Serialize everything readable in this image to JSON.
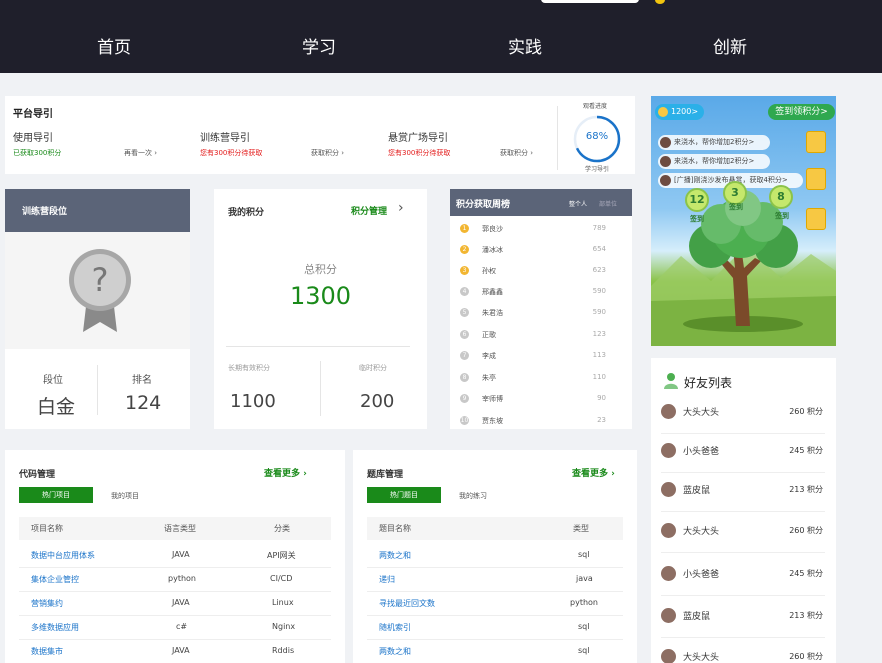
{
  "nav": {
    "items": [
      "首页",
      "学习",
      "实践",
      "创新"
    ]
  },
  "guide": {
    "title": "平台导引",
    "items": [
      {
        "name": "使用导引",
        "status": "已获取300积分",
        "action": "再看一次"
      },
      {
        "name": "训练营导引",
        "status": "您有300积分待获取",
        "action": "获取积分"
      },
      {
        "name": "悬赏广场导引",
        "status": "您有300积分待获取",
        "action": "获取积分"
      }
    ],
    "progress_title": "观看进度",
    "progress_value": 68,
    "progress_text": "68%",
    "progress_label": "学习导引"
  },
  "rank": {
    "title": "训练营段位",
    "level_label": "段位",
    "level_value": "白金",
    "rank_label": "排名",
    "rank_value": "124"
  },
  "points": {
    "title": "我的积分",
    "manage": "积分管理",
    "total_label": "总积分",
    "total_value": "1300",
    "long_label": "长期有效积分",
    "long_value": "1100",
    "temp_label": "临时积分",
    "temp_value": "200"
  },
  "weekly": {
    "title": "积分获取周榜",
    "tab_personal": "整个人",
    "tab_other": "部单位",
    "rows": [
      {
        "rank": "1",
        "name": "郭良沙",
        "score": "789"
      },
      {
        "rank": "2",
        "name": "潘冰冰",
        "score": "654"
      },
      {
        "rank": "3",
        "name": "孙权",
        "score": "623"
      },
      {
        "rank": "4",
        "name": "邢鑫鑫",
        "score": "590"
      },
      {
        "rank": "5",
        "name": "朱君浩",
        "score": "590"
      },
      {
        "rank": "6",
        "name": "正歌",
        "score": "123"
      },
      {
        "rank": "7",
        "name": "李成",
        "score": "113"
      },
      {
        "rank": "8",
        "name": "朱亭",
        "score": "110"
      },
      {
        "rank": "9",
        "name": "宰师博",
        "score": "90"
      },
      {
        "rank": "10",
        "name": "贾东坡",
        "score": "23"
      }
    ]
  },
  "game": {
    "coins": "1200>",
    "sign_button": "签到领积分>",
    "messages": [
      "来浇水，帮你增加2积分>",
      "来浇水，帮你增加2积分>",
      "[广播]刚浇沙发布悬赏，获取4积分>"
    ],
    "orbs": [
      {
        "value": "12",
        "label": "签到"
      },
      {
        "value": "3",
        "label": "签到"
      },
      {
        "value": "8",
        "label": "签到"
      }
    ]
  },
  "friends": {
    "title": "好友列表",
    "list": [
      {
        "name": "大头大头",
        "points": "260 积分"
      },
      {
        "name": "小头爸爸",
        "points": "245 积分"
      },
      {
        "name": "蓝皮鼠",
        "points": "213 积分"
      },
      {
        "name": "大头大头",
        "points": "260 积分"
      },
      {
        "name": "小头爸爸",
        "points": "245 积分"
      },
      {
        "name": "蓝皮鼠",
        "points": "213 积分"
      },
      {
        "name": "大头大头",
        "points": "260 积分"
      }
    ]
  },
  "code": {
    "title": "代码管理",
    "more": "查看更多",
    "tab_hot": "热门项目",
    "tab_mine": "我的项目",
    "headers": [
      "项目名称",
      "语言类型",
      "分类"
    ],
    "rows": [
      [
        "数据中台应用体系",
        "JAVA",
        "API网关"
      ],
      [
        "集体企业管控",
        "python",
        "CI/CD"
      ],
      [
        "营销集约",
        "JAVA",
        "Linux"
      ],
      [
        "多维数据应用",
        "c#",
        "Nginx"
      ],
      [
        "数据集市",
        "JAVA",
        "Rddis"
      ]
    ]
  },
  "questions": {
    "title": "题库管理",
    "more": "查看更多",
    "tab_hot": "热门题目",
    "tab_mine": "我的练习",
    "headers": [
      "题目名称",
      "类型"
    ],
    "rows": [
      [
        "两数之和",
        "sql"
      ],
      [
        "递归",
        "java"
      ],
      [
        "寻找最近回文数",
        "python"
      ],
      [
        "随机索引",
        "sql"
      ],
      [
        "两数之和",
        "sql"
      ]
    ]
  },
  "colors": {
    "nav_bg": "#1f1f2b",
    "accent_green": "#1a8a1a",
    "link_blue": "#1a73c9",
    "header_slate": "#5b6478",
    "warn_red": "#e31b1b"
  }
}
